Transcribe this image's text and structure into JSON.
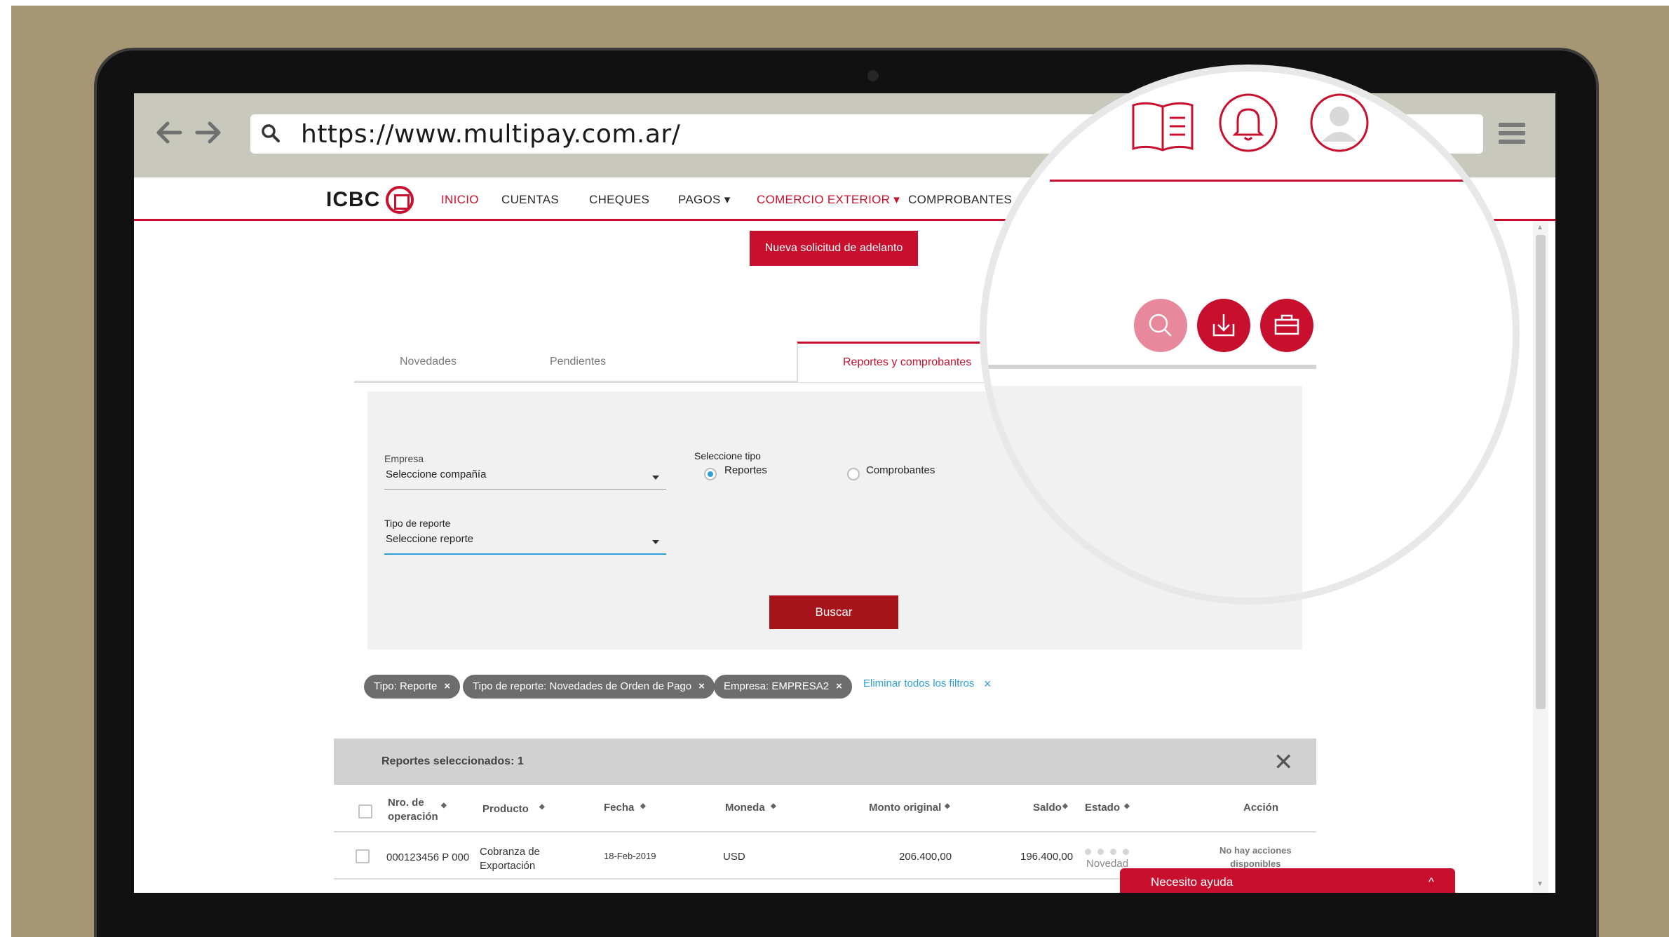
{
  "browser": {
    "url": "https://www.multipay.com.ar/",
    "back_icon": "back-arrow-icon",
    "forward_icon": "forward-arrow-icon"
  },
  "site": {
    "logo": "ICBC",
    "nav": [
      "INICIO",
      "CUENTAS",
      "CHEQUES",
      "PAGOS ▾",
      "COMERCIO EXTERIOR ▾",
      "COMPROBANTES"
    ],
    "accent_color": "#c8102e"
  },
  "cta_label": "Nueva solicitud de adelanto",
  "tabs": [
    "Novedades",
    "Pendientes",
    "Reportes y comprobantes"
  ],
  "filters": {
    "empresa_label": "Empresa",
    "empresa_value": "Seleccione compañía",
    "tipo_reporte_label": "Tipo de reporte",
    "tipo_reporte_value": "Seleccione reporte",
    "seleccione_tipo_label": "Seleccione tipo",
    "radio_reportes": "Reportes",
    "radio_comprobantes": "Comprobantes",
    "buscar_label": "Buscar"
  },
  "chips": [
    "Tipo: Reporte",
    "Tipo de reporte: Novedades de Orden de Pago",
    "Empresa: EMPRESA2"
  ],
  "chip_close": "×",
  "clear_filters_label": "Eliminar todos los filtros",
  "results": {
    "title": "Reportes seleccionados: 1",
    "close": "✕",
    "headers": {
      "nro_line1": "Nro. de",
      "nro_line2": "operación",
      "producto": "Producto",
      "fecha": "Fecha",
      "moneda": "Moneda",
      "monto": "Monto original",
      "saldo": "Saldo",
      "estado": "Estado",
      "accion": "Acción"
    },
    "row": {
      "nro": "000123456 P 000",
      "producto_line1": "Cobranza de",
      "producto_line2": "Exportación",
      "fecha": "18-Feb-2019",
      "moneda": "USD",
      "monto": "206.400,00",
      "saldo": "196.400,00",
      "estado": "Novedad",
      "accion_line1": "No hay acciones",
      "accion_line2": "disponibles"
    }
  },
  "help_label": "Necesito ayuda",
  "help_chevron": "^",
  "magnifier_icons": [
    "book-icon",
    "bell-icon",
    "user-icon",
    "search-icon",
    "download-icon",
    "briefcase-icon"
  ]
}
